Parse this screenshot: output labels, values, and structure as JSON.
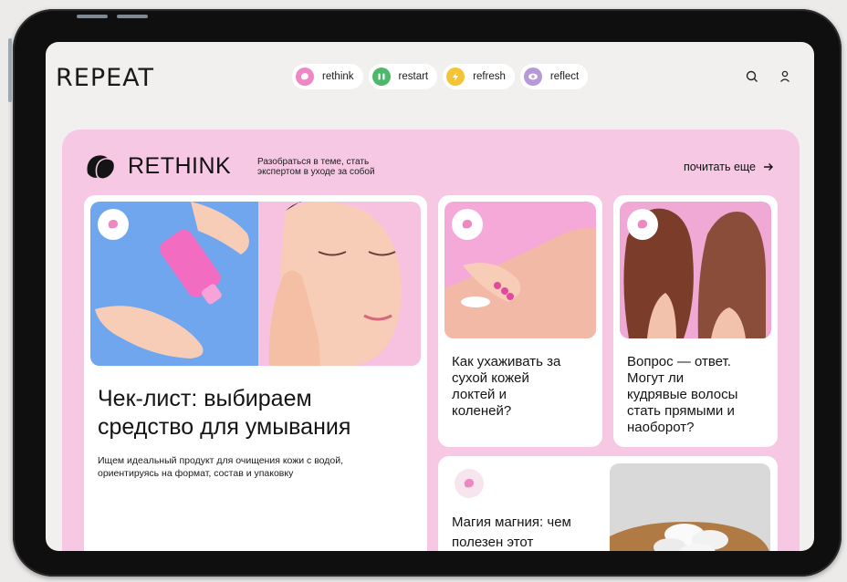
{
  "header": {
    "logo": "REPEAT",
    "nav": [
      {
        "label": "rethink",
        "color": "#ef87c4",
        "icon": "rethink-icon"
      },
      {
        "label": "restart",
        "color": "#4db86b",
        "icon": "restart-icon"
      },
      {
        "label": "refresh",
        "color": "#f5c336",
        "icon": "refresh-icon"
      },
      {
        "label": "reflect",
        "color": "#b69ad8",
        "icon": "reflect-icon"
      }
    ],
    "search_icon": "search-icon",
    "profile_icon": "user-icon"
  },
  "section": {
    "title": "RETHINK",
    "subtitle_line1": "Разобраться в теме, стать",
    "subtitle_line2": "экспертом в уходе за собой",
    "more_label": "почитать еще",
    "more_icon": "arrow-right-icon",
    "accent": "#f6c8e4"
  },
  "cards": {
    "main": {
      "title_line1": "Чек-лист: выбираем",
      "title_line2": "средство для умывания",
      "desc_line1": "Ищем идеальный продукт для очищения кожи с водой,",
      "desc_line2": "ориентируясь на формат, состав и упаковку"
    },
    "elbows": {
      "title_line1": "Как ухаживать за",
      "title_line2": "сухой кожей",
      "title_line3": "локтей и",
      "title_line4": "коленей?"
    },
    "hair": {
      "title_line1": "Вопрос — ответ.",
      "title_line2": "Могут ли",
      "title_line3": "кудрявые волосы",
      "title_line4": "стать прямыми и",
      "title_line5": "наоборот?"
    },
    "magnesium": {
      "title_line1": "Магия магния: чем",
      "title_line2": "полезен этот"
    }
  }
}
